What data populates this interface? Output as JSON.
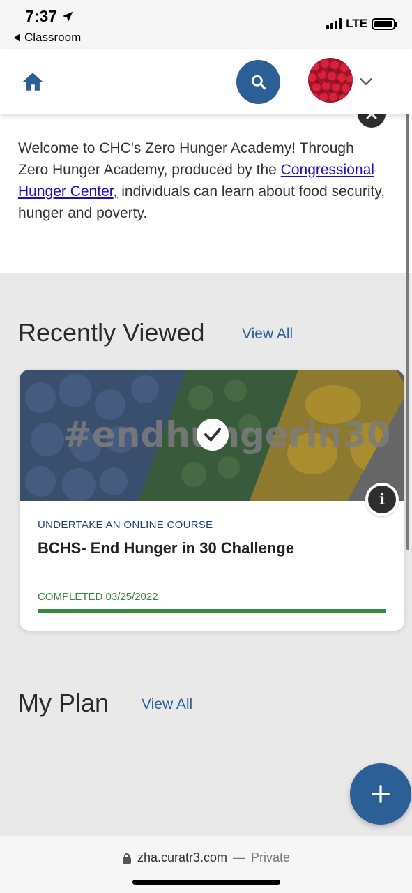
{
  "status_bar": {
    "time": "7:37",
    "back_app": "Classroom",
    "network": "LTE"
  },
  "header": {
    "home_icon": "home-icon",
    "search_icon": "search-icon",
    "menu_icon": "chevron-down-icon"
  },
  "welcome": {
    "text_before": "Welcome to CHC's Zero Hunger Academy! Through Zero Hunger Academy, produced by the ",
    "link_text": "Congressional Hunger Center,",
    "text_after": " individuals can learn about food security, hunger and poverty."
  },
  "recently_viewed": {
    "title": "Recently Viewed",
    "view_all": "View All",
    "card": {
      "image_text": "#endhungerin30",
      "type": "UNDERTAKE AN ONLINE COURSE",
      "title": "BCHS- End Hunger in 30 Challenge",
      "status": "COMPLETED 03/25/2022",
      "progress_percent": 100
    }
  },
  "my_plan": {
    "title": "My Plan",
    "view_all": "View All"
  },
  "url_bar": {
    "domain": "zha.curatr3.com",
    "separator": "—",
    "mode": "Private"
  },
  "colors": {
    "brand_blue": "#2c5f95",
    "complete_green": "#2e8b3a",
    "link_blue": "#1a0dcc"
  }
}
